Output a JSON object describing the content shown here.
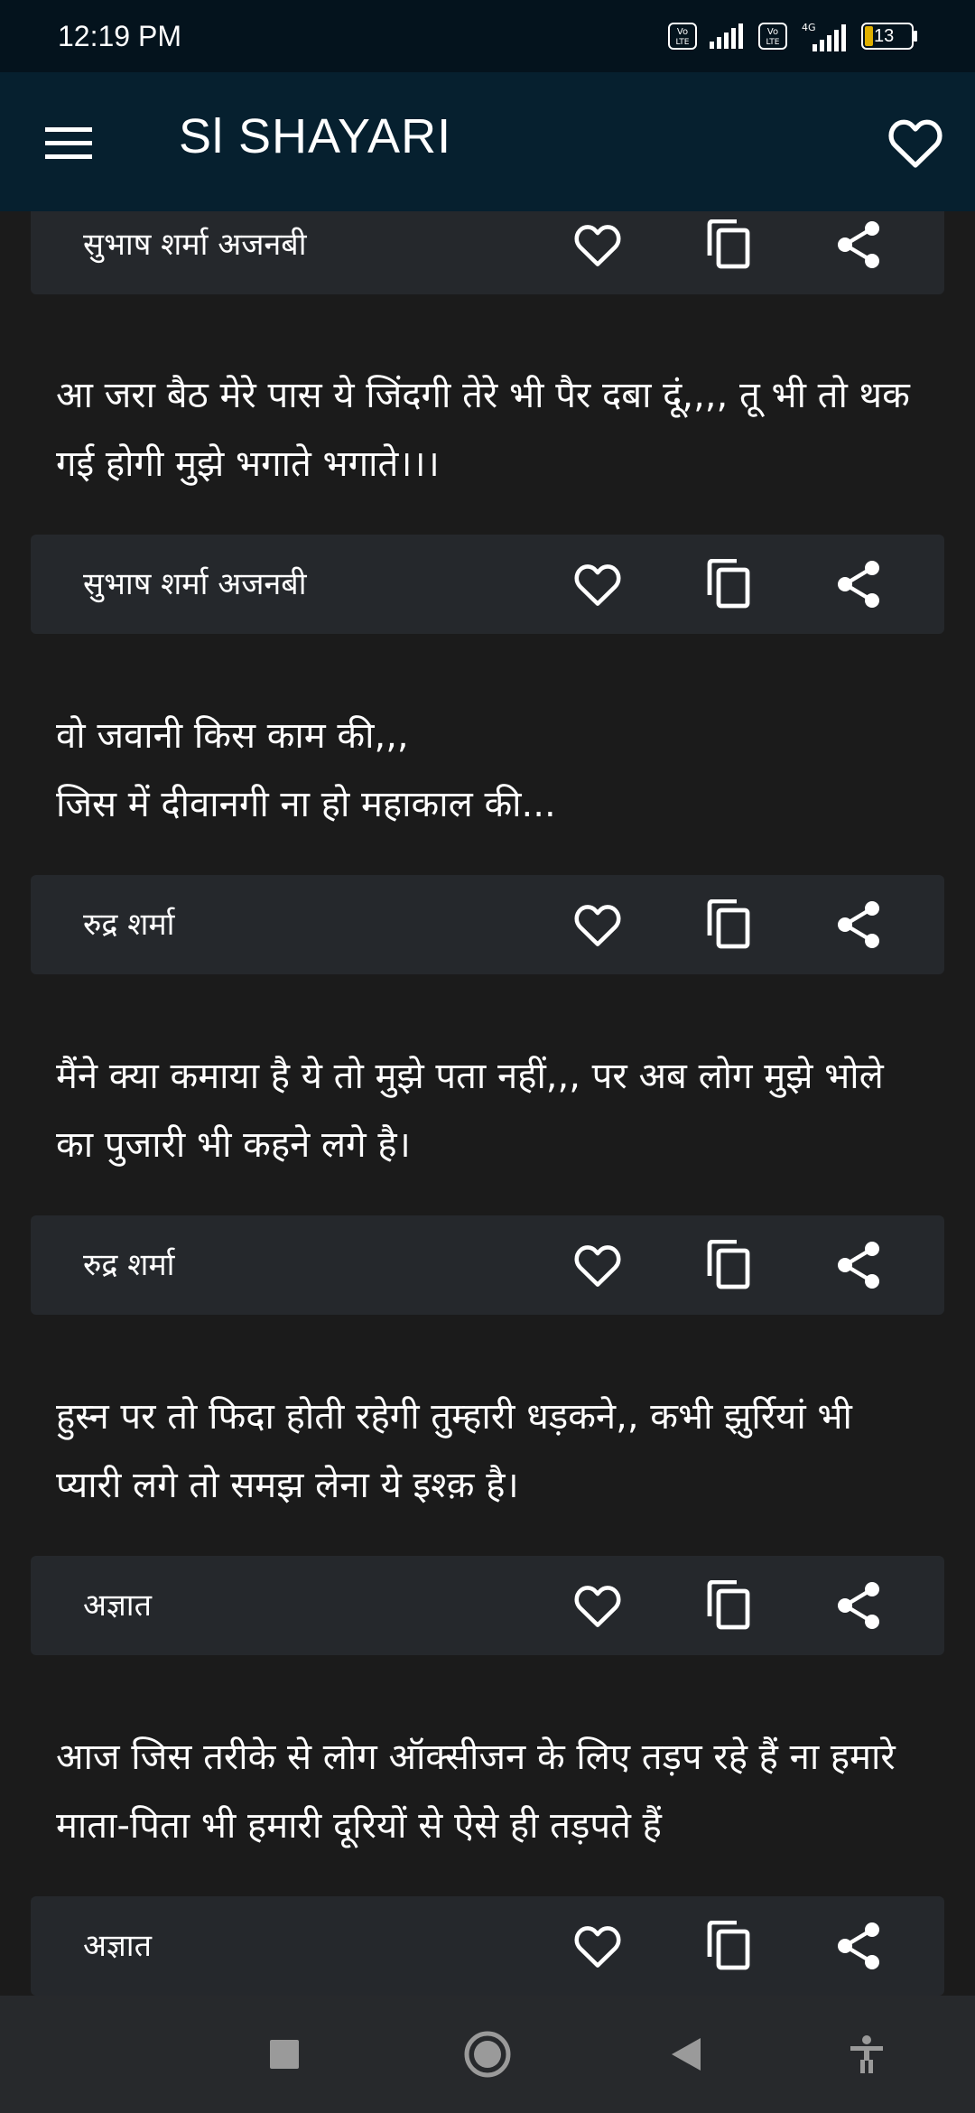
{
  "status_bar": {
    "time": "12:19 PM",
    "volte1": "Vo LTE",
    "volte2": "Vo LTE",
    "network": "4G",
    "battery": "13"
  },
  "app_bar": {
    "title": "Sl SHAYARI"
  },
  "cards": [
    {
      "text": "",
      "author": "सुभाष शर्मा अजनबी"
    },
    {
      "text": "आ जरा बैठ मेरे पास ये जिंदगी तेरे भी पैर दबा दूं,,,, तू भी तो थक गई होगी मुझे भगाते भगाते।।।",
      "author": "सुभाष शर्मा अजनबी"
    },
    {
      "text": "वो जवानी किस काम की,,,\nजिस में दीवानगी ना हो महाकाल की...",
      "author": "रुद्र शर्मा"
    },
    {
      "text": "मैंने क्या कमाया है ये तो मुझे पता नहीं,,, पर अब लोग मुझे भोले का पुजारी भी कहने लगे है।",
      "author": "रुद्र शर्मा"
    },
    {
      "text": "हुस्न पर तो फिदा होती रहेगी तुम्हारी धड़कने,, कभी झुर्रियां भी प्यारी लगे तो समझ लेना ये इश्क़ है।",
      "author": "अज्ञात"
    },
    {
      "text": "आज जिस तरीके से लोग ऑक्सीजन के लिए तड़प रहे हैं ना हमारे माता-पिता भी हमारी दूरियों से ऐसे ही तड़पते हैं",
      "author": "अज्ञात"
    }
  ],
  "icons": {
    "menu": "menu-icon",
    "favorites": "heart-outline-icon",
    "like": "heart-outline-icon",
    "copy": "copy-icon",
    "share": "share-icon",
    "nav_recent": "square-icon",
    "nav_home": "circle-icon",
    "nav_back": "triangle-back-icon",
    "nav_accessibility": "accessibility-icon"
  },
  "colors": {
    "status_bar": "#04131d",
    "app_bar": "#06202f",
    "background": "#1b1b1b",
    "card_footer": "#25282c",
    "nav_bar": "#27292c"
  }
}
